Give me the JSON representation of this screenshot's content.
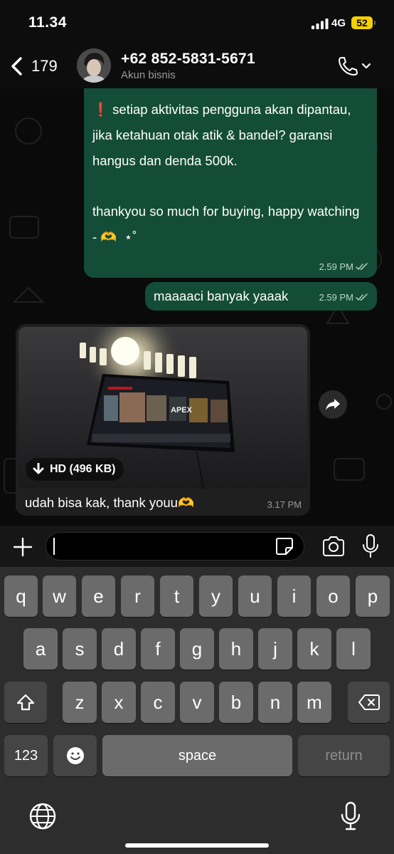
{
  "status_bar": {
    "time": "11.34",
    "network": "4G",
    "battery": "52"
  },
  "header": {
    "unread_count": "179",
    "contact_number": "+62 852-5831-5671",
    "subtitle": "Akun bisnis"
  },
  "messages": [
    {
      "direction": "outgoing",
      "text": "❗ setiap aktivitas pengguna akan dipantau, jika ketahuan otak atik & bandel? garansi hangus dan denda 500k.\n\nthankyou so much for buying, happy watching - 🫶  ⋆˚",
      "time": "2.59 PM",
      "status": "read"
    },
    {
      "direction": "outgoing",
      "text": "maaaaci banyak yaaak",
      "time": "2.59 PM",
      "status": "read"
    },
    {
      "direction": "incoming",
      "type": "photo",
      "photo_label": "HD (496 KB)",
      "caption": "udah bisa kak, thank youu🫶",
      "time": "3.17 PM"
    }
  ],
  "composer": {
    "placeholder": ""
  },
  "keyboard": {
    "row1": [
      "q",
      "w",
      "e",
      "r",
      "t",
      "y",
      "u",
      "i",
      "o",
      "p"
    ],
    "row2": [
      "a",
      "s",
      "d",
      "f",
      "g",
      "h",
      "j",
      "k",
      "l"
    ],
    "row3": [
      "z",
      "x",
      "c",
      "v",
      "b",
      "n",
      "m"
    ],
    "numbers_label": "123",
    "space_label": "space",
    "return_label": "return"
  },
  "colors": {
    "outgoing_bubble": "#144d37",
    "incoming_bubble": "#1f1f1f",
    "read_ticks": "#bcd6c8",
    "battery": "#f5d000",
    "key": "#6b6b6b",
    "key_dark": "#454545",
    "keyboard_bg": "#2d2d2d"
  },
  "icons": {
    "back": "chevron-left-icon",
    "call": "phone-icon",
    "forward": "share-icon",
    "download": "arrow-down-icon",
    "attach": "plus-icon",
    "sticker": "sticker-icon",
    "camera": "camera-icon",
    "mic": "microphone-icon",
    "shift": "shift-icon",
    "delete": "backspace-icon",
    "emoji": "emoji-icon",
    "globe": "globe-icon"
  }
}
